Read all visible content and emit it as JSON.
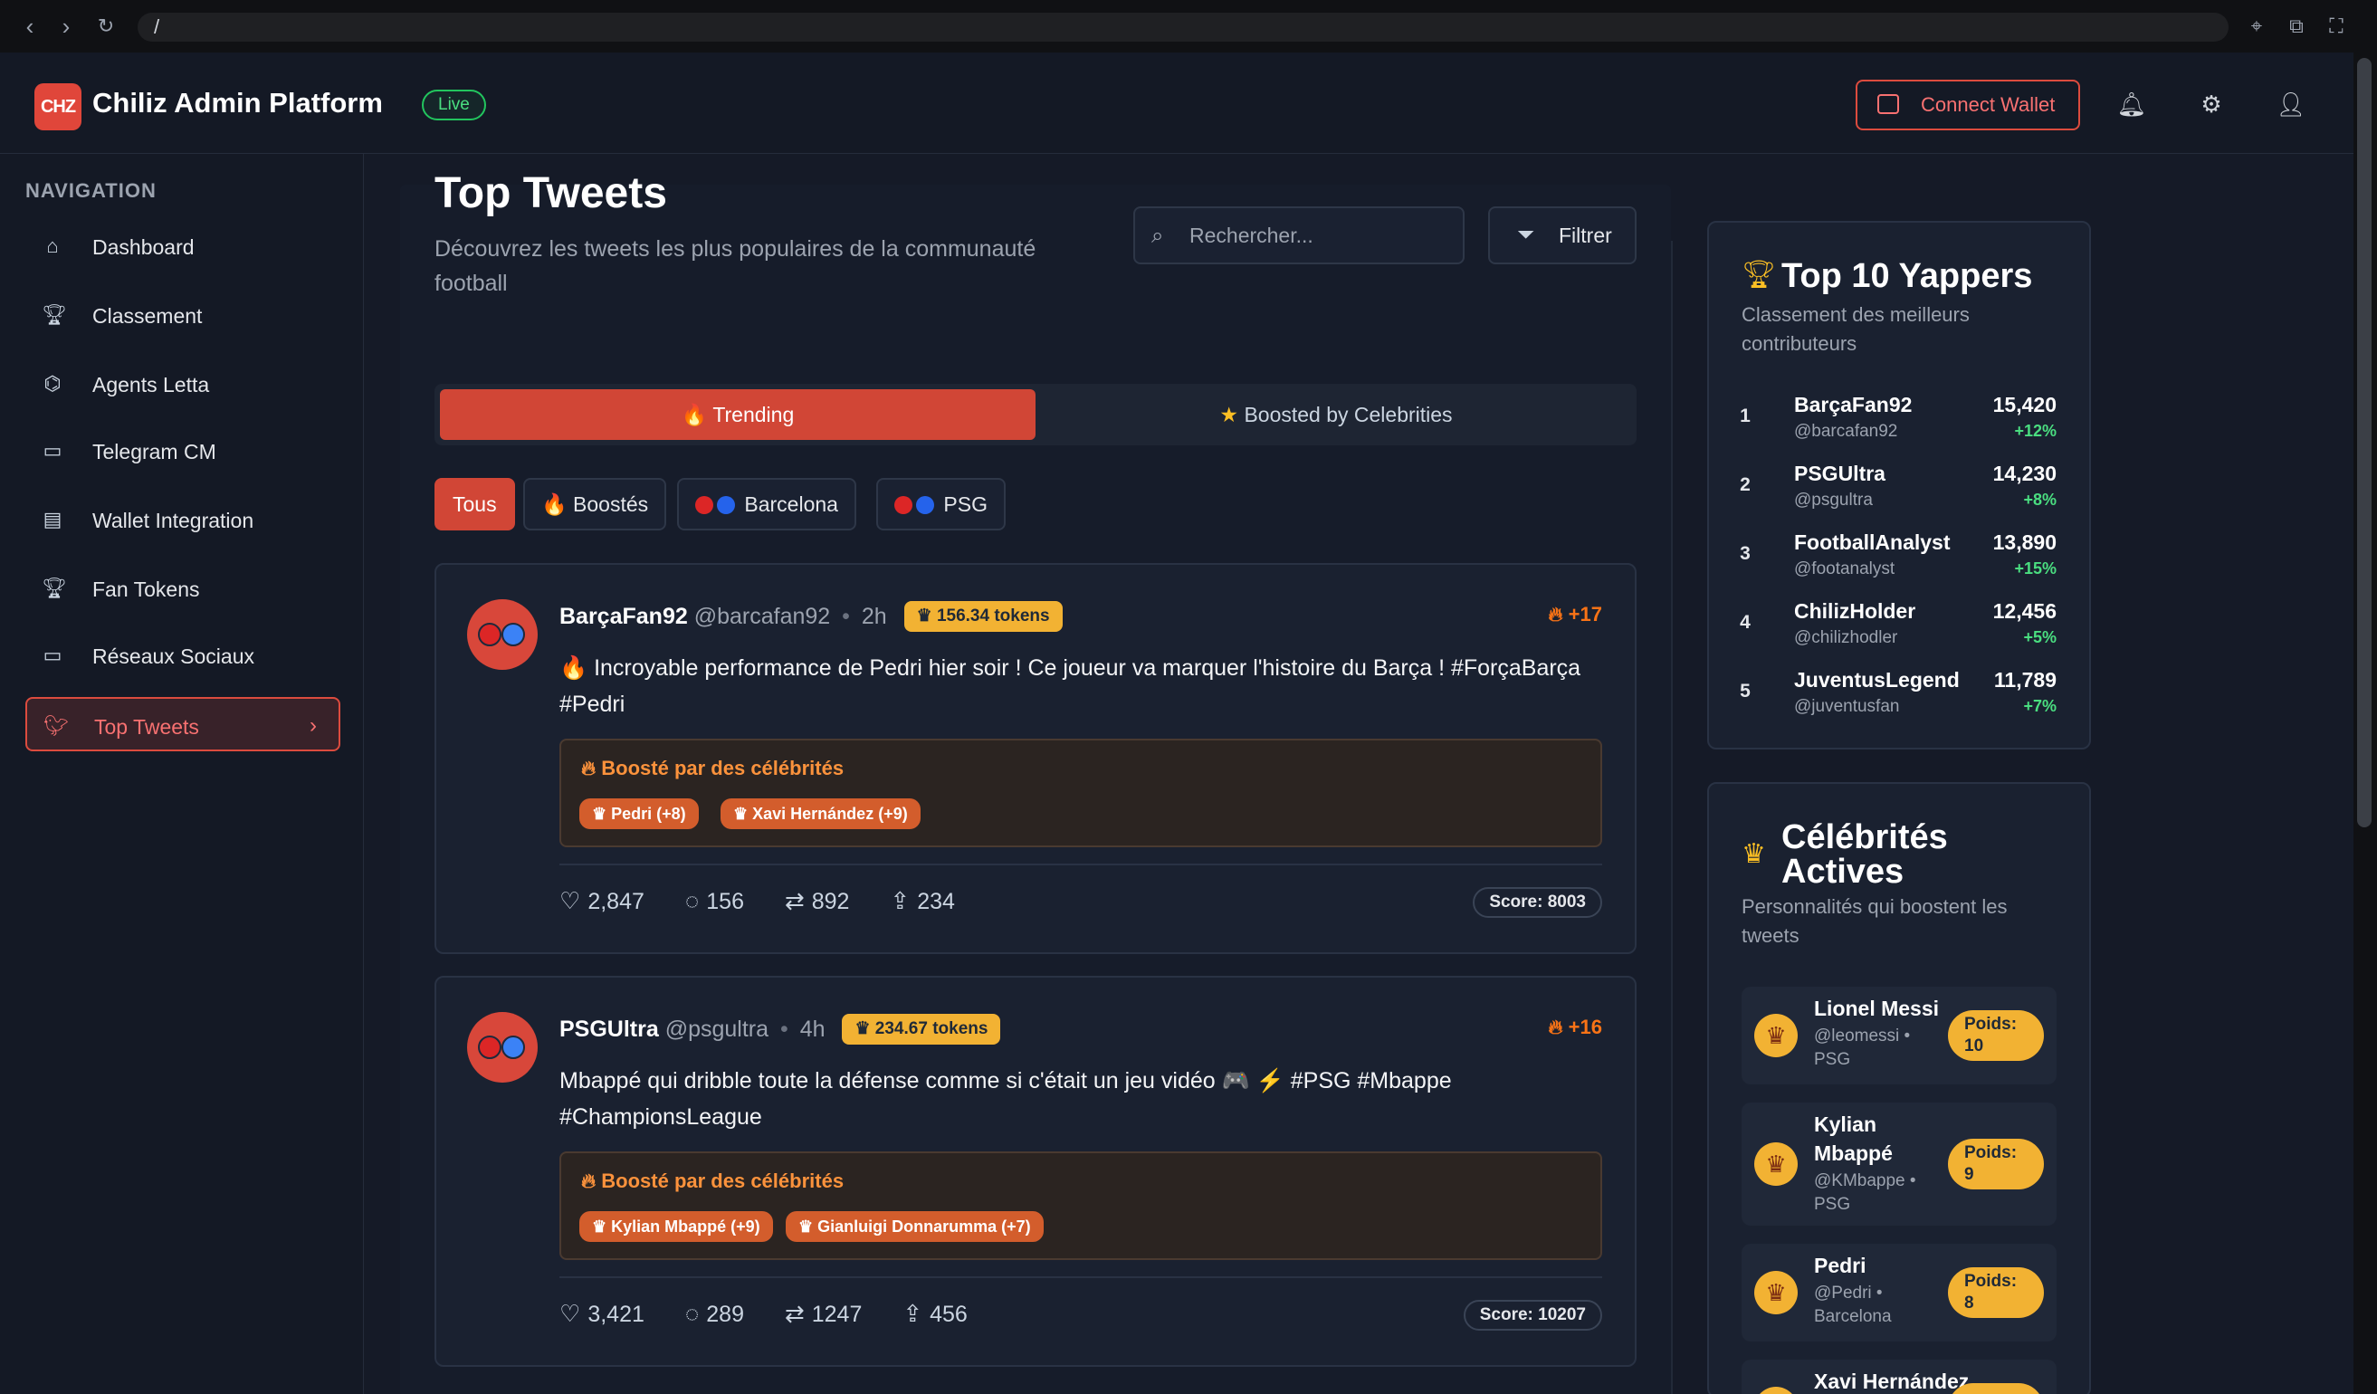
{
  "browser": {
    "url": "/",
    "back_icon": "back-arrow-icon",
    "forward_icon": "forward-arrow-icon",
    "reload_icon": "reload-icon"
  },
  "header": {
    "logo": "CHZ",
    "title": "Chiliz Admin Platform",
    "live_badge": "Live",
    "connect_wallet": "Connect Wallet"
  },
  "sidebar": {
    "title": "NAVIGATION",
    "items": [
      {
        "label": "Dashboard",
        "icon": "home-icon"
      },
      {
        "label": "Classement",
        "icon": "trophy-icon"
      },
      {
        "label": "Agents Letta",
        "icon": "robot-icon"
      },
      {
        "label": "Telegram CM",
        "icon": "chat-icon"
      },
      {
        "label": "Wallet Integration",
        "icon": "wallet-icon"
      },
      {
        "label": "Fan Tokens",
        "icon": "trophy-icon"
      },
      {
        "label": "Réseaux Sociaux",
        "icon": "chat-icon"
      },
      {
        "label": "Top Tweets",
        "icon": "bird-icon",
        "active": true
      }
    ]
  },
  "main": {
    "title": "Top Tweets",
    "subtitle": "Découvrez les tweets les plus populaires de la communauté football",
    "search_placeholder": "Rechercher...",
    "filter_label": "Filtrer",
    "tabs": [
      {
        "label": "🔥 Trending",
        "active": true
      },
      {
        "label": "Boosted by Celebrities",
        "active": false
      }
    ],
    "chips": [
      {
        "label": "Tous",
        "active": true
      },
      {
        "label": "🔥 Boostés"
      },
      {
        "label": "Barcelona"
      },
      {
        "label": "PSG"
      }
    ],
    "tweets": [
      {
        "name": "BarçaFan92",
        "handle": "@barcafan92",
        "time": "2h",
        "tokens": "156.34 tokens",
        "hot": "+17",
        "text": "🔥 Incroyable performance de Pedri hier soir ! Ce joueur va marquer l'histoire du Barça ! #ForçaBarça #Pedri",
        "boost_title": "Boosté par des célébrités",
        "boosters": [
          "Pedri (+8)",
          "Xavi Hernández (+9)"
        ],
        "likes": "2,847",
        "comments": "156",
        "retweets": "892",
        "shares": "234",
        "score": "Score: 8003"
      },
      {
        "name": "PSGUltra",
        "handle": "@psgultra",
        "time": "4h",
        "tokens": "234.67 tokens",
        "hot": "+16",
        "text": "Mbappé qui dribble toute la défense comme si c'était un jeu vidéo 🎮 ⚡ #PSG #Mbappe #ChampionsLeague",
        "boost_title": "Boosté par des célébrités",
        "boosters": [
          "Kylian Mbappé (+9)",
          "Gianluigi Donnarumma (+7)"
        ],
        "likes": "3,421",
        "comments": "289",
        "retweets": "1247",
        "shares": "456",
        "score": "Score: 10207"
      }
    ]
  },
  "yappers": {
    "title": "Top 10 Yappers",
    "subtitle": "Classement des meilleurs contributeurs",
    "items": [
      {
        "rank": "1",
        "name": "BarçaFan92",
        "handle": "@barcafan92",
        "score": "15,420",
        "delta": "+12%"
      },
      {
        "rank": "2",
        "name": "PSGUltra",
        "handle": "@psgultra",
        "score": "14,230",
        "delta": "+8%"
      },
      {
        "rank": "3",
        "name": "FootballAnalyst",
        "handle": "@footanalyst",
        "score": "13,890",
        "delta": "+15%"
      },
      {
        "rank": "4",
        "name": "ChilizHolder",
        "handle": "@chilizhodler",
        "score": "12,456",
        "delta": "+5%"
      },
      {
        "rank": "5",
        "name": "JuventusLegend",
        "handle": "@juventusfan",
        "score": "11,789",
        "delta": "+7%"
      }
    ]
  },
  "celebrities": {
    "title_line1": "Célébrités",
    "title_line2": "Actives",
    "subtitle": "Personnalités qui boostent les tweets",
    "items": [
      {
        "name": "Lionel Messi",
        "meta1": "@leomessi •",
        "meta2": "PSG",
        "poids1": "Poids:",
        "poids2": "10"
      },
      {
        "name_line1": "Kylian",
        "name_line2": "Mbappé",
        "meta1": "@KMbappe •",
        "meta2": "PSG",
        "poids1": "Poids:",
        "poids2": "9"
      },
      {
        "name": "Pedri",
        "meta1": "@Pedri •",
        "meta2": "Barcelona",
        "poids1": "Poids:",
        "poids2": "8"
      },
      {
        "name": "Xavi Hernández"
      }
    ]
  },
  "colors": {
    "accent": "#dc4b3e",
    "background": "#151a27",
    "gold": "#f2b233",
    "positive": "#4ade80"
  }
}
